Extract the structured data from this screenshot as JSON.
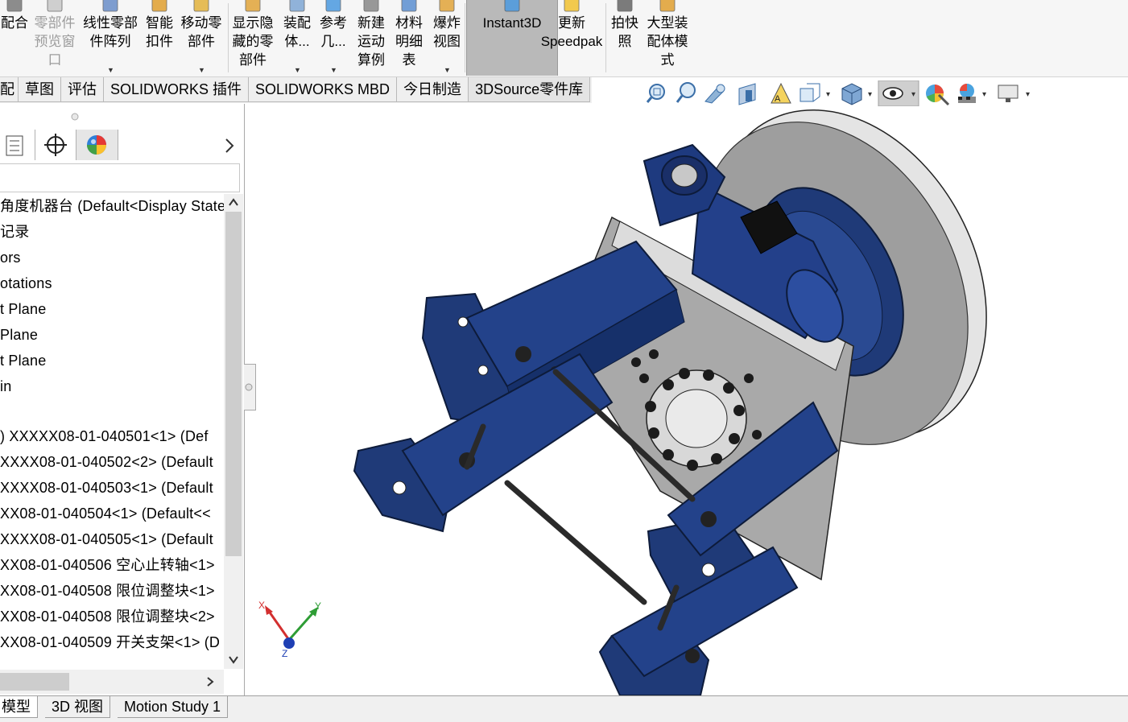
{
  "ribbon": {
    "buttons": [
      {
        "name": "mate-button",
        "label": "配合",
        "enabled": true
      },
      {
        "name": "component-preview-button",
        "label": "零部件\n预览窗\n口",
        "enabled": false
      },
      {
        "name": "linear-pattern-button",
        "label": "线性零部\n件阵列",
        "enabled": true
      },
      {
        "name": "smart-fastener-button",
        "label": "智能\n扣件",
        "enabled": true
      },
      {
        "name": "move-component-button",
        "label": "移动零\n部件",
        "enabled": true
      },
      {
        "name": "show-hidden-button",
        "label": "显示隐\n藏的零\n部件",
        "enabled": true
      },
      {
        "name": "assembly-features-button",
        "label": "装配\n体...",
        "enabled": true
      },
      {
        "name": "reference-geometry-button",
        "label": "参考\n几...",
        "enabled": true
      },
      {
        "name": "new-motion-study-button",
        "label": "新建\n运动\n算例",
        "enabled": true
      },
      {
        "name": "bom-button",
        "label": "材料\n明细\n表",
        "enabled": true
      },
      {
        "name": "exploded-view-button",
        "label": "爆炸\n视图",
        "enabled": true
      },
      {
        "name": "instant3d-button",
        "label": "Instant3D",
        "enabled": true
      },
      {
        "name": "update-speedpak-button",
        "label": "更新\nSpeedpak",
        "enabled": true
      },
      {
        "name": "snapshot-button",
        "label": "拍快\n照",
        "enabled": true
      },
      {
        "name": "large-assembly-button",
        "label": "大型装\n配体模\n式",
        "enabled": true
      }
    ]
  },
  "tabs": [
    "配",
    "草图",
    "评估",
    "SOLIDWORKS 插件",
    "SOLIDWORKS MBD",
    "今日制造",
    "3DSource零件库"
  ],
  "tree": {
    "items": [
      "角度机器台 (Default<Display State",
      "记录",
      "ors",
      "otations",
      "t Plane",
      "Plane",
      "t Plane",
      "in",
      "",
      ") XXXXX08-01-040501<1> (Def",
      "XXXX08-01-040502<2> (Default",
      "XXXX08-01-040503<1> (Default",
      "XX08-01-040504<1> (Default<<",
      "XXXX08-01-040505<1> (Default",
      "XX08-01-040506 空心止转轴<1>",
      "XX08-01-040508 限位调整块<1>",
      "XX08-01-040508 限位调整块<2>",
      "XX08-01-040509 开关支架<1> (D"
    ]
  },
  "bottom_tabs": [
    "模型",
    "3D 视图",
    "Motion Study 1"
  ],
  "triad": {
    "x": "X",
    "y": "Y",
    "z": "Z"
  },
  "colors": {
    "part_blue": "#1f3a78",
    "part_grey": "#9e9e9e",
    "accent": "#b9b9b9"
  }
}
